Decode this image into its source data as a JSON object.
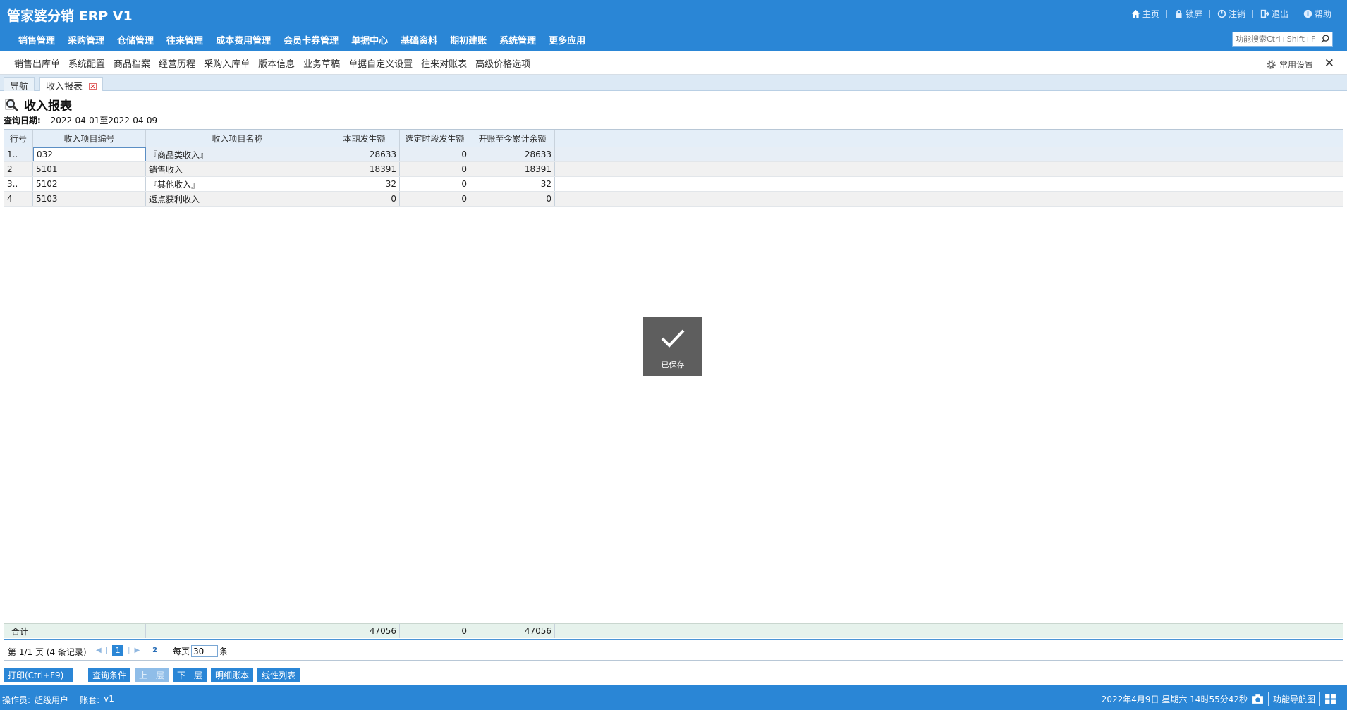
{
  "app": {
    "title": "管家婆分销 ERP V1"
  },
  "top_actions": [
    {
      "icon": "home-icon",
      "label": "主页"
    },
    {
      "icon": "lock-icon",
      "label": "锁屏"
    },
    {
      "icon": "logout-circle-icon",
      "label": "注销"
    },
    {
      "icon": "exit-icon",
      "label": "退出"
    },
    {
      "icon": "help-icon",
      "label": "帮助"
    }
  ],
  "menu": [
    "销售管理",
    "采购管理",
    "仓储管理",
    "往来管理",
    "成本费用管理",
    "会员卡券管理",
    "单据中心",
    "基础资料",
    "期初建账",
    "系统管理",
    "更多应用"
  ],
  "search": {
    "placeholder": "功能搜索Ctrl+Shift+F"
  },
  "shortcuts": [
    "销售出库单",
    "系统配置",
    "商品档案",
    "经营历程",
    "采购入库单",
    "版本信息",
    "业务草稿",
    "单据自定义设置",
    "往来对账表",
    "高级价格选项"
  ],
  "settings_label": "常用设置",
  "close_label": "✕",
  "tabs": [
    {
      "label": "导航"
    },
    {
      "label": "收入报表"
    }
  ],
  "report": {
    "title": "收入报表",
    "query_date_label": "查询日期:",
    "query_date_value": "2022-04-01至2022-04-09"
  },
  "grid": {
    "columns": [
      "行号",
      "收入项目编号",
      "收入项目名称",
      "本期发生额",
      "选定时段发生额",
      "开账至今累计余额"
    ],
    "rows": [
      {
        "no": "1..",
        "code": "032",
        "name": "『商品类收入』",
        "current": "28633",
        "period": "0",
        "cumulative": "28633"
      },
      {
        "no": "2",
        "code": "5101",
        "name": "销售收入",
        "current": "18391",
        "period": "0",
        "cumulative": "18391"
      },
      {
        "no": "3..",
        "code": "5102",
        "name": "『其他收入』",
        "current": "32",
        "period": "0",
        "cumulative": "32"
      },
      {
        "no": "4",
        "code": "5103",
        "name": "返点获利收入",
        "current": "0",
        "period": "0",
        "cumulative": "0"
      }
    ],
    "total": {
      "label": "合计",
      "current": "47056",
      "period": "0",
      "cumulative": "47056"
    }
  },
  "pager": {
    "info": "第 1/1 页 (4 条记录)",
    "current_page": "1",
    "selected_page": "2",
    "per_page_label": "每页",
    "per_page_value": "30",
    "per_page_unit": "条"
  },
  "buttons": [
    {
      "label": "打印(Ctrl+F9)",
      "disabled": false
    },
    {
      "label": "查询条件",
      "disabled": false
    },
    {
      "label": "上一层",
      "disabled": true
    },
    {
      "label": "下一层",
      "disabled": false
    },
    {
      "label": "明细账本",
      "disabled": false
    },
    {
      "label": "线性列表",
      "disabled": false
    }
  ],
  "status": {
    "operator_label": "操作员:",
    "operator_value": "超级用户",
    "account_label": "账套:",
    "account_value": "v1",
    "datetime": "2022年4月9日  星期六  14时55分42秒",
    "nav_label": "功能导航图"
  },
  "toast": {
    "label": "已保存"
  },
  "colors": {
    "primary": "#2a86d6",
    "header_row": "#e4eef8",
    "total_row": "#e6f2ec"
  }
}
